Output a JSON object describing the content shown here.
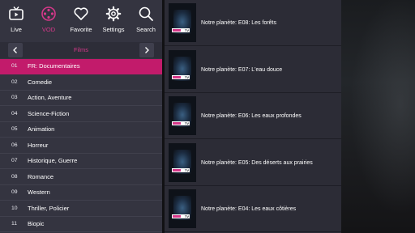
{
  "nav": [
    {
      "label": "Live",
      "icon": "tv-icon"
    },
    {
      "label": "VOD",
      "icon": "film-reel-icon"
    },
    {
      "label": "Favorite",
      "icon": "heart-icon"
    },
    {
      "label": "Settings",
      "icon": "gear-icon"
    },
    {
      "label": "Search",
      "icon": "search-icon"
    }
  ],
  "category_header": {
    "title": "Films"
  },
  "categories": [
    {
      "num": "01",
      "label": "FR: Documentaires",
      "selected": true
    },
    {
      "num": "02",
      "label": "Comedie"
    },
    {
      "num": "03",
      "label": "Action, Aventure"
    },
    {
      "num": "04",
      "label": "Science-Fiction"
    },
    {
      "num": "05",
      "label": "Animation"
    },
    {
      "num": "06",
      "label": "Horreur"
    },
    {
      "num": "07",
      "label": "Historique, Guerre"
    },
    {
      "num": "08",
      "label": "Romance"
    },
    {
      "num": "09",
      "label": "Western"
    },
    {
      "num": "10",
      "label": "Thriller, Policier"
    },
    {
      "num": "11",
      "label": "Biopic"
    }
  ],
  "vod_items": [
    {
      "title": "Notre planète: E08: Les forêts"
    },
    {
      "title": "Notre planète: E07: L'eau douce"
    },
    {
      "title": "Notre planète: E06: Les eaux profondes"
    },
    {
      "title": "Notre planète: E05: Des déserts aux prairies"
    },
    {
      "title": "Notre planète: E04: Les eaux côtières"
    }
  ],
  "colors": {
    "accent": "#c21b6b",
    "panel": "#343440",
    "list": "#2c2c36"
  }
}
